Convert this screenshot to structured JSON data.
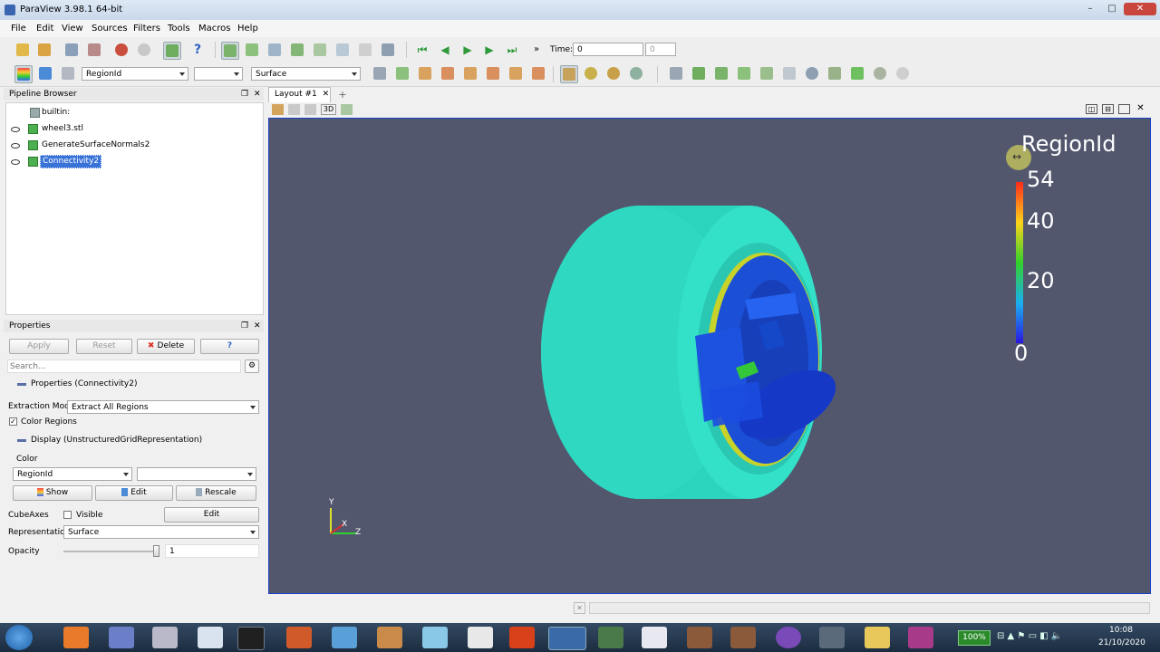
{
  "window": {
    "title": "ParaView 3.98.1 64-bit",
    "buttons": [
      "–",
      "□",
      "✕"
    ]
  },
  "menu": [
    "File",
    "Edit",
    "View",
    "Sources",
    "Filters",
    "Tools",
    "Macros",
    "Help"
  ],
  "time": {
    "label": "Time:",
    "value": "0",
    "index": "0"
  },
  "toolbar2": {
    "color_by": "RegionId",
    "component": "",
    "representation": "Surface"
  },
  "layout_tab": {
    "label": "Layout #1",
    "close": "✕",
    "add": "+"
  },
  "view_3d_label": "3D",
  "pipeline": {
    "title": "Pipeline Browser",
    "items": [
      {
        "label": "builtin:",
        "eye": false,
        "selected": false,
        "indent": 0
      },
      {
        "label": "wheel3.stl",
        "eye": true,
        "selected": false,
        "indent": 1
      },
      {
        "label": "GenerateSurfaceNormals2",
        "eye": true,
        "selected": false,
        "indent": 1
      },
      {
        "label": "Connectivity2",
        "eye": true,
        "selected": true,
        "indent": 1
      }
    ]
  },
  "properties": {
    "title": "Properties",
    "apply": "Apply",
    "reset": "Reset",
    "delete": "Delete",
    "help": "?",
    "search_placeholder": "Search...",
    "section_props": "Properties (Connectivity2)",
    "extraction_mode_label": "Extraction Mode",
    "extraction_mode_value": "Extract All Regions",
    "color_regions_label": "Color Regions",
    "color_regions_checked": true,
    "section_display": "Display (UnstructuredGridRepresentation)",
    "color_label": "Color",
    "color_value": "RegionId",
    "color_component": "",
    "show": "Show",
    "edit": "Edit",
    "rescale": "Rescale",
    "cubeaxes_label": "CubeAxes",
    "visible_label": "Visible",
    "cubeaxes_edit": "Edit",
    "representation_label": "Representation",
    "representation_value": "Surface",
    "opacity_label": "Opacity",
    "opacity_value": "1",
    "opacity_fraction": 1.0
  },
  "legend": {
    "title": "RegionId",
    "ticks": [
      "54",
      "40",
      "20",
      "0"
    ],
    "tick_values": [
      54,
      40,
      20,
      0
    ],
    "range": [
      0,
      54
    ]
  },
  "axes": {
    "x": "X",
    "y": "Y",
    "z": "Z"
  },
  "taskbar": {
    "zoom": "100%",
    "time": "10:08",
    "date": "21/10/2020"
  },
  "colors": {
    "viewport_bg": "#52576e",
    "tire": "#2fd9c1",
    "rim": "#1a4fd6",
    "selection": "#3a73d8",
    "border": "#1a40c8"
  }
}
